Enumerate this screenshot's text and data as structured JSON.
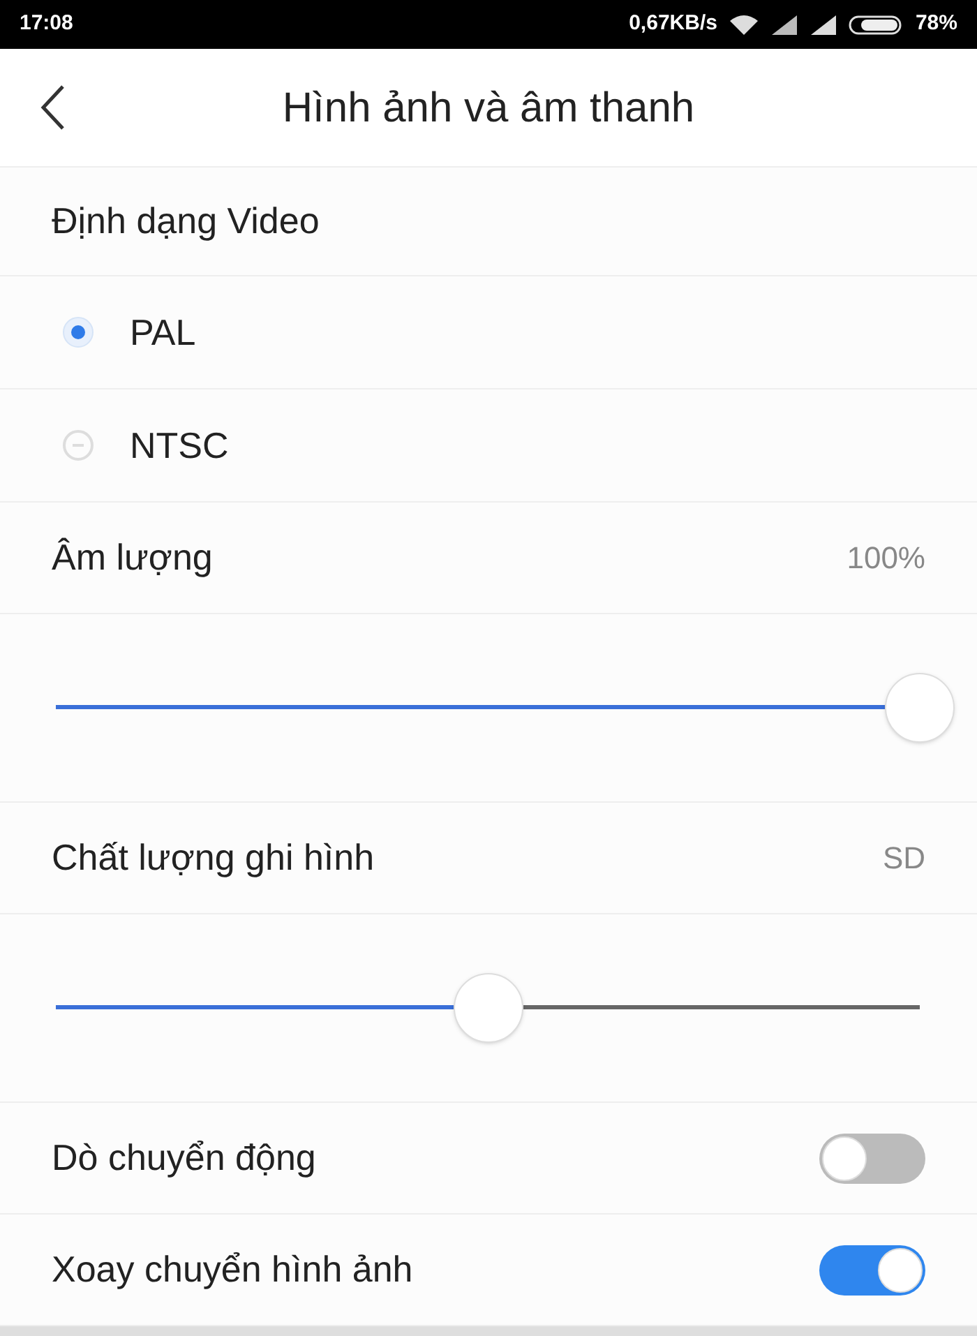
{
  "status_bar": {
    "time": "17:08",
    "speed": "0,67KB/s",
    "battery": "78%"
  },
  "header": {
    "title": "Hình ảnh và âm thanh"
  },
  "items": [
    {
      "kind": "heading",
      "label": "Định dạng Video"
    },
    {
      "kind": "radio",
      "label": "PAL",
      "selected": true
    },
    {
      "kind": "radio",
      "label": "NTSC",
      "selected": false
    },
    {
      "kind": "value",
      "label": "Âm lượng",
      "value": "100%"
    },
    {
      "kind": "slider",
      "level": 1.0
    },
    {
      "kind": "value",
      "label": "Chất lượng ghi hình",
      "value": "SD"
    },
    {
      "kind": "slider",
      "level": 0.5
    },
    {
      "kind": "toggle",
      "label": "Dò chuyển động",
      "on": false
    },
    {
      "kind": "toggle",
      "label": "Xoay chuyển hình ảnh",
      "on": true
    }
  ]
}
